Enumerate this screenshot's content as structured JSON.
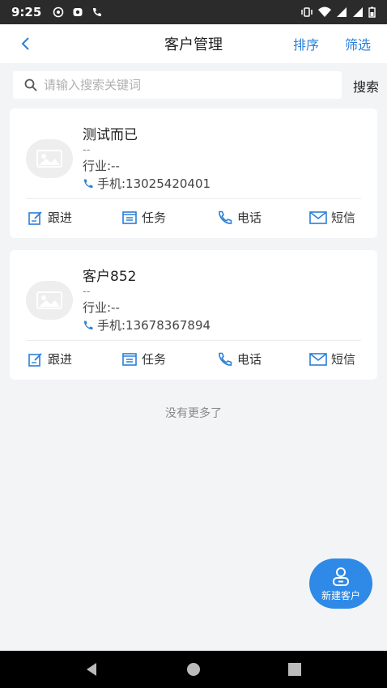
{
  "status_bar": {
    "time": "9:25"
  },
  "header": {
    "title": "客户管理",
    "sort_label": "排序",
    "filter_label": "筛选"
  },
  "search": {
    "placeholder": "请输入搜索关键词",
    "button_label": "搜索"
  },
  "customers": [
    {
      "name": "测试而已",
      "sub": "--",
      "industry": "行业:--",
      "phone": "手机:13025420401"
    },
    {
      "name": "客户852",
      "sub": "--",
      "industry": "行业:--",
      "phone": "手机:13678367894"
    }
  ],
  "actions": {
    "follow": "跟进",
    "task": "任务",
    "call": "电话",
    "sms": "短信"
  },
  "footer": {
    "no_more": "没有更多了"
  },
  "fab": {
    "label": "新建客户"
  },
  "colors": {
    "accent": "#2e8ae6",
    "link": "#2a7fd8"
  }
}
